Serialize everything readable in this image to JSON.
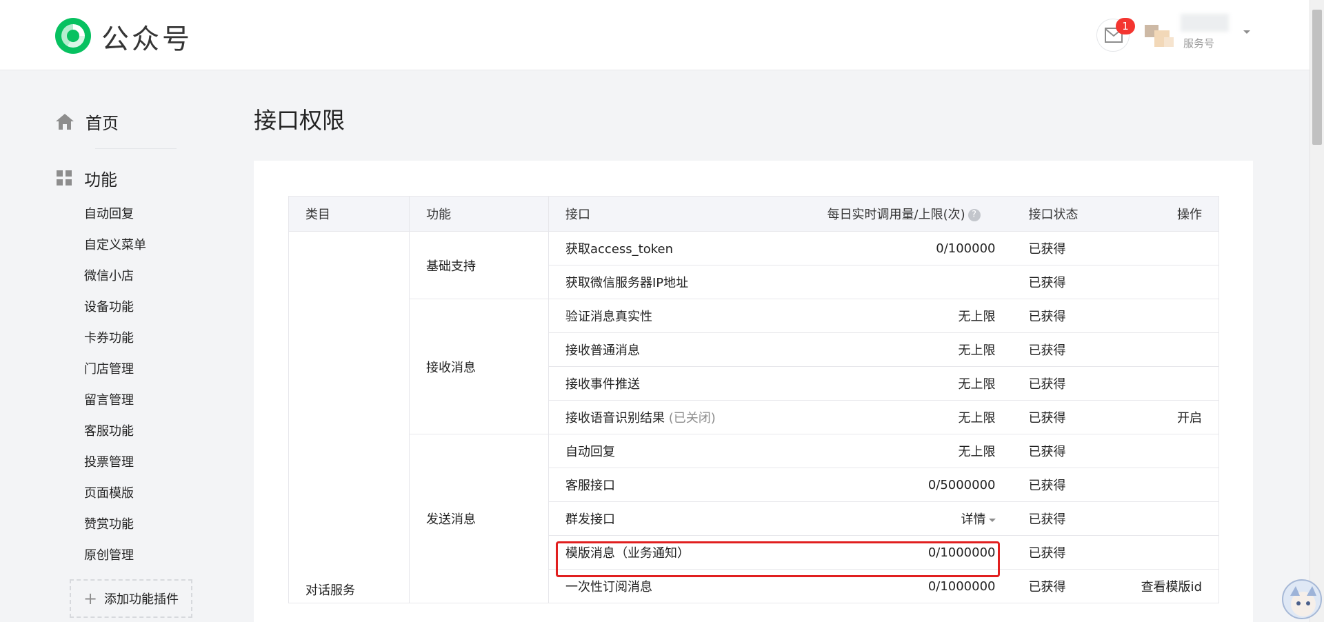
{
  "header": {
    "logo_text": "公众号",
    "notification_count": "1",
    "account_type": "服务号"
  },
  "sidebar": {
    "home_label": "首页",
    "features_label": "功能",
    "items": [
      "自动回复",
      "自定义菜单",
      "微信小店",
      "设备功能",
      "卡券功能",
      "门店管理",
      "留言管理",
      "客服功能",
      "投票管理",
      "页面模版",
      "赞赏功能",
      "原创管理"
    ],
    "add_plugin_label": "添加功能插件"
  },
  "main": {
    "title": "接口权限",
    "table": {
      "headers": {
        "category": "类目",
        "function": "功能",
        "interface": "接口",
        "quota": "每日实时调用量/上限(次)",
        "status": "接口状态",
        "operation": "操作"
      },
      "category_label": "对话服务",
      "groups": [
        {
          "function": "基础支持",
          "rows": [
            {
              "interface": "获取access_token",
              "quota": "0/100000",
              "status": "已获得",
              "op": ""
            },
            {
              "interface": "获取微信服务器IP地址",
              "quota": "",
              "status": "已获得",
              "op": ""
            }
          ]
        },
        {
          "function": "接收消息",
          "rows": [
            {
              "interface": "验证消息真实性",
              "quota": "无上限",
              "status": "已获得",
              "op": ""
            },
            {
              "interface": "接收普通消息",
              "quota": "无上限",
              "status": "已获得",
              "op": ""
            },
            {
              "interface": "接收事件推送",
              "quota": "无上限",
              "status": "已获得",
              "op": ""
            },
            {
              "interface": "接收语音识别结果",
              "note": "(已关闭)",
              "quota": "无上限",
              "status": "已获得",
              "op": "开启"
            }
          ]
        },
        {
          "function": "发送消息",
          "rows": [
            {
              "interface": "自动回复",
              "quota": "无上限",
              "status": "已获得",
              "op": ""
            },
            {
              "interface": "客服接口",
              "quota": "0/5000000",
              "status": "已获得",
              "op": ""
            },
            {
              "interface": "群发接口",
              "quota": "详情",
              "status": "已获得",
              "op": ""
            },
            {
              "interface": "模版消息（业务通知）",
              "quota": "0/1000000",
              "status": "已获得",
              "op": ""
            },
            {
              "interface": "一次性订阅消息",
              "quota": "0/1000000",
              "status": "已获得",
              "op": "查看模版id"
            }
          ]
        }
      ]
    }
  },
  "colors": {
    "link": "#576b95",
    "muted": "#8d8d8d",
    "highlight_border": "#e11f1f",
    "badge": "#f43530",
    "logo_green": "#07c160"
  }
}
